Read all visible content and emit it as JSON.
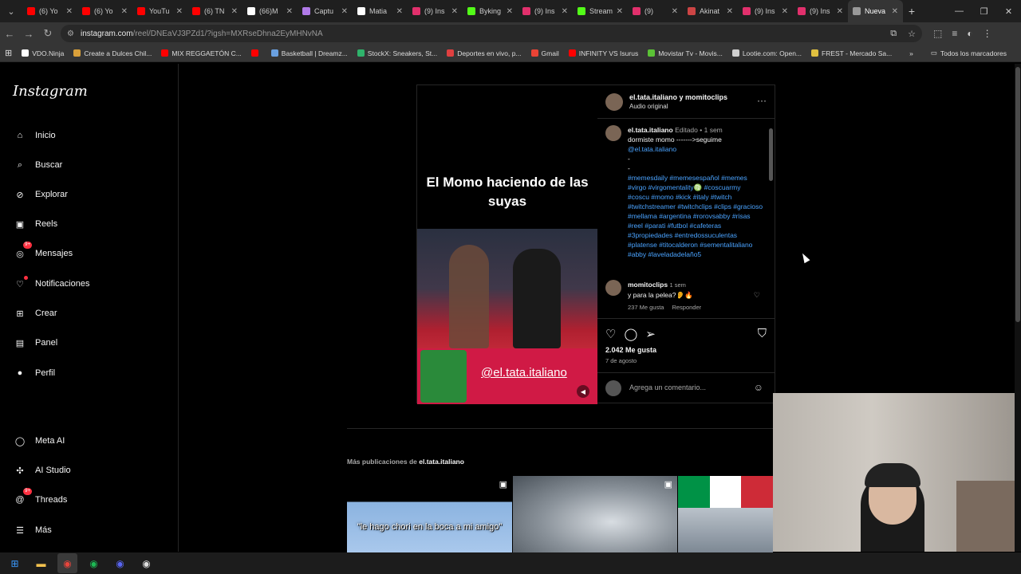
{
  "tabs": [
    {
      "label": "(6) Yo",
      "color": "#ff0000",
      "active": false
    },
    {
      "label": "(6) Yo",
      "color": "#ff0000",
      "active": false
    },
    {
      "label": "YouTu",
      "color": "#ff0000",
      "active": false
    },
    {
      "label": "(6) TN",
      "color": "#ff0000",
      "active": false
    },
    {
      "label": "(66)M",
      "color": "#ffffff",
      "active": false
    },
    {
      "label": "Captu",
      "color": "#b07ae8",
      "active": false
    },
    {
      "label": "Matia",
      "color": "#ffffff",
      "active": false
    },
    {
      "label": "(9) Ins",
      "color": "#e1306c",
      "active": false
    },
    {
      "label": "Byking",
      "color": "#53fc18",
      "active": false
    },
    {
      "label": "(9) Ins",
      "color": "#e1306c",
      "active": false
    },
    {
      "label": "Stream",
      "color": "#53fc18",
      "active": false
    },
    {
      "label": "(9)",
      "color": "#e1306c",
      "active": false
    },
    {
      "label": "Akinat",
      "color": "#c44",
      "active": false
    },
    {
      "label": "(9) Ins",
      "color": "#e1306c",
      "active": false
    },
    {
      "label": "(9) Ins",
      "color": "#e1306c",
      "active": false
    },
    {
      "label": "Nueva",
      "color": "#999999",
      "active": true
    }
  ],
  "address": {
    "domain": "instagram.com",
    "path": "/reel/DNEaVJ3PZd1/?igsh=MXRseDhna2EyMHNvNA"
  },
  "bookmarks": [
    {
      "label": "VDO.Ninja",
      "color": "#ffffff"
    },
    {
      "label": "Create a Dulces Chil...",
      "color": "#d9a03a"
    },
    {
      "label": "MIX REGGAETÓN C...",
      "color": "#ff0000"
    },
    {
      "label": "",
      "color": "#ff0000"
    },
    {
      "label": "Basketball | Dreamz...",
      "color": "#6aa0e0"
    },
    {
      "label": "StockX: Sneakers, St...",
      "color": "#2fb36b"
    },
    {
      "label": "Deportes en vivo, p...",
      "color": "#e04040"
    },
    {
      "label": "Gmail",
      "color": "#ea4335"
    },
    {
      "label": "INFINITY VS Isurus",
      "color": "#ff0000"
    },
    {
      "label": "Movistar Tv - Movis...",
      "color": "#5bc236"
    },
    {
      "label": "Lootie.com: Open...",
      "color": "#d0d0d0"
    },
    {
      "label": "FREST - Mercado Sa...",
      "color": "#e0c040"
    }
  ],
  "bookmarks_all": "Todos los marcadores",
  "sidebar": {
    "logo": "Instagram",
    "items": [
      {
        "label": "Inicio",
        "icon": "home-icon",
        "glyph": "⌂"
      },
      {
        "label": "Buscar",
        "icon": "search-icon",
        "glyph": "⌕"
      },
      {
        "label": "Explorar",
        "icon": "compass-icon",
        "glyph": "⊘"
      },
      {
        "label": "Reels",
        "icon": "reels-icon",
        "glyph": "▣"
      },
      {
        "label": "Mensajes",
        "icon": "messenger-icon",
        "glyph": "◎",
        "badge": "9+"
      },
      {
        "label": "Notificaciones",
        "icon": "heart-icon",
        "glyph": "♡",
        "dot": true
      },
      {
        "label": "Crear",
        "icon": "plus-square-icon",
        "glyph": "⊞"
      },
      {
        "label": "Panel",
        "icon": "chart-icon",
        "glyph": "▤"
      },
      {
        "label": "Perfil",
        "icon": "profile-avatar-icon",
        "glyph": "●"
      }
    ],
    "bottom": [
      {
        "label": "Meta AI",
        "icon": "meta-ai-icon",
        "glyph": "◯"
      },
      {
        "label": "AI Studio",
        "icon": "ai-studio-icon",
        "glyph": "✣"
      },
      {
        "label": "Threads",
        "icon": "threads-icon",
        "glyph": "@",
        "badge": "9+"
      },
      {
        "label": "Más",
        "icon": "menu-icon",
        "glyph": "☰"
      }
    ]
  },
  "post": {
    "video_title": "El Momo haciendo de las suyas",
    "video_handle": "@el.tata.italiano",
    "author": "el.tata.italiano y momitoclips",
    "audio": "Audio original",
    "caption": {
      "user": "el.tata.italiano",
      "edited": "Editado",
      "time": "1 sem",
      "text": "dormiste momo ------->seguime",
      "mention": "@el.tata.italiano",
      "dash1": "-",
      "dash2": "-",
      "hashtags": "#memesdaily #memesespañol #memes #virgo #virgomentality♍ #coscuarmy #coscu #momo #kick #italy #twitch #twitchstreamer #twitchclips #clips #gracioso #mellama #argentina #rorovsabby #risas #reel #parati #futbol #cafeteras #3propiedades #entredossuculentas #platense #titocalderon #sementalitaliano #abby #laveladadelaño5"
    },
    "comment": {
      "user": "momitoclips",
      "time": "1 sem",
      "text": "y para la pelea?👂🔥",
      "likes": "237 Me gusta",
      "reply": "Responder"
    },
    "likes": "2.042 Me gusta",
    "date": "7 de agosto",
    "add_comment_placeholder": "Agrega un comentario..."
  },
  "more": {
    "prefix": "Más publicaciones de",
    "user": "el.tata.italiano",
    "thumb1_caption": "\"le hago chori en la boca a mi amigo\""
  },
  "taskbar": [
    {
      "name": "windows-start-icon",
      "glyph": "⊞",
      "color": "#3b9bff"
    },
    {
      "name": "file-explorer-icon",
      "glyph": "▬",
      "color": "#f2c14e"
    },
    {
      "name": "chrome-icon",
      "glyph": "◉",
      "color": "#e8453c",
      "active": true
    },
    {
      "name": "spotify-icon",
      "glyph": "◉",
      "color": "#1db954"
    },
    {
      "name": "discord-icon",
      "glyph": "◉",
      "color": "#5865f2"
    },
    {
      "name": "obs-icon",
      "glyph": "◉",
      "color": "#dddddd"
    }
  ]
}
